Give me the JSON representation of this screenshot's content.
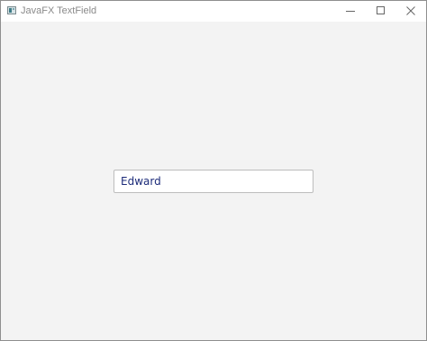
{
  "window": {
    "title": "JavaFX TextField",
    "controls": {
      "minimize": "minimize-icon",
      "maximize": "maximize-icon",
      "close": "close-icon"
    }
  },
  "main": {
    "text_field": {
      "value": "Edward"
    }
  },
  "colors": {
    "content_background": "#f3f3f3",
    "text_value": "#1d2c7a",
    "field_border": "#bdbdbd"
  }
}
